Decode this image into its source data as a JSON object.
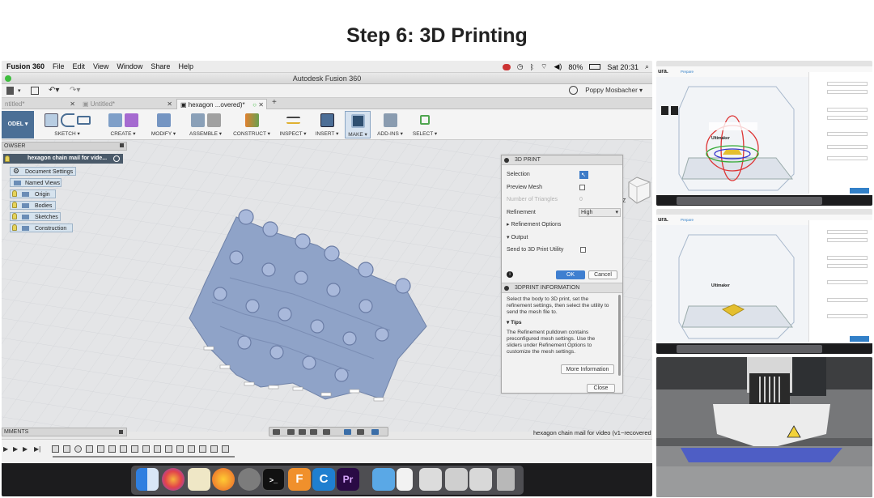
{
  "page": {
    "title": "Step 6: 3D Printing"
  },
  "mac_menubar": {
    "app_name": "Fusion 360",
    "menus": [
      "File",
      "Edit",
      "View",
      "Window",
      "Share",
      "Help"
    ],
    "battery": "80%",
    "clock": "Sat 20:31"
  },
  "window": {
    "title": "Autodesk Fusion 360"
  },
  "quick_access": {
    "user": "Poppy Mosbacher"
  },
  "doc_tabs": [
    {
      "label": "ntitled*",
      "active": false
    },
    {
      "label": "Untitled*",
      "active": false
    },
    {
      "label": "hexagon ...overed)*",
      "active": true
    }
  ],
  "toolbar": {
    "mode": "ODEL ▾",
    "groups": [
      "SKETCH ▾",
      "CREATE ▾",
      "MODIFY ▾",
      "ASSEMBLE ▾",
      "CONSTRUCT ▾",
      "INSPECT ▾",
      "INSERT ▾",
      "MAKE ▾",
      "ADD-INS ▾",
      "SELECT ▾"
    ]
  },
  "browser": {
    "header": "OWSER",
    "root": "hexagon chain mail for vide...",
    "items": [
      "Document Settings",
      "Named Views",
      "Origin",
      "Bodies",
      "Sketches",
      "Construction"
    ]
  },
  "print_panel": {
    "title": "3D PRINT",
    "selection_label": "Selection",
    "preview_mesh_label": "Preview Mesh",
    "triangles_label": "Number of Triangles",
    "triangles_value": "0",
    "refinement_label": "Refinement",
    "refinement_value": "High",
    "refinement_options": "Refinement Options",
    "output_label": "Output",
    "send_label": "Send to 3D Print Utility",
    "ok_label": "OK",
    "cancel_label": "Cancel"
  },
  "info_panel": {
    "title": "3DPRINT INFORMATION",
    "body": "Select the body to 3D print, set the refinement settings, then select the utility to send the mesh file to.",
    "tips_title": "Tips",
    "tips_body": "The Refinement pulldown contains preconfigured mesh settings. Use the sliders under Refinement Options to customize the mesh settings.",
    "more_label": "More Information",
    "close_label": "Close"
  },
  "comments": {
    "label": "MMENTS"
  },
  "status": {
    "file_name": "hexagon chain mail for video (v1~recovered"
  },
  "viewcube": {
    "axis_label": "Z"
  },
  "thumbnails": {
    "cura_logo": "ura.",
    "cura_tab": "Prepare",
    "brand": "Ultimaker"
  }
}
